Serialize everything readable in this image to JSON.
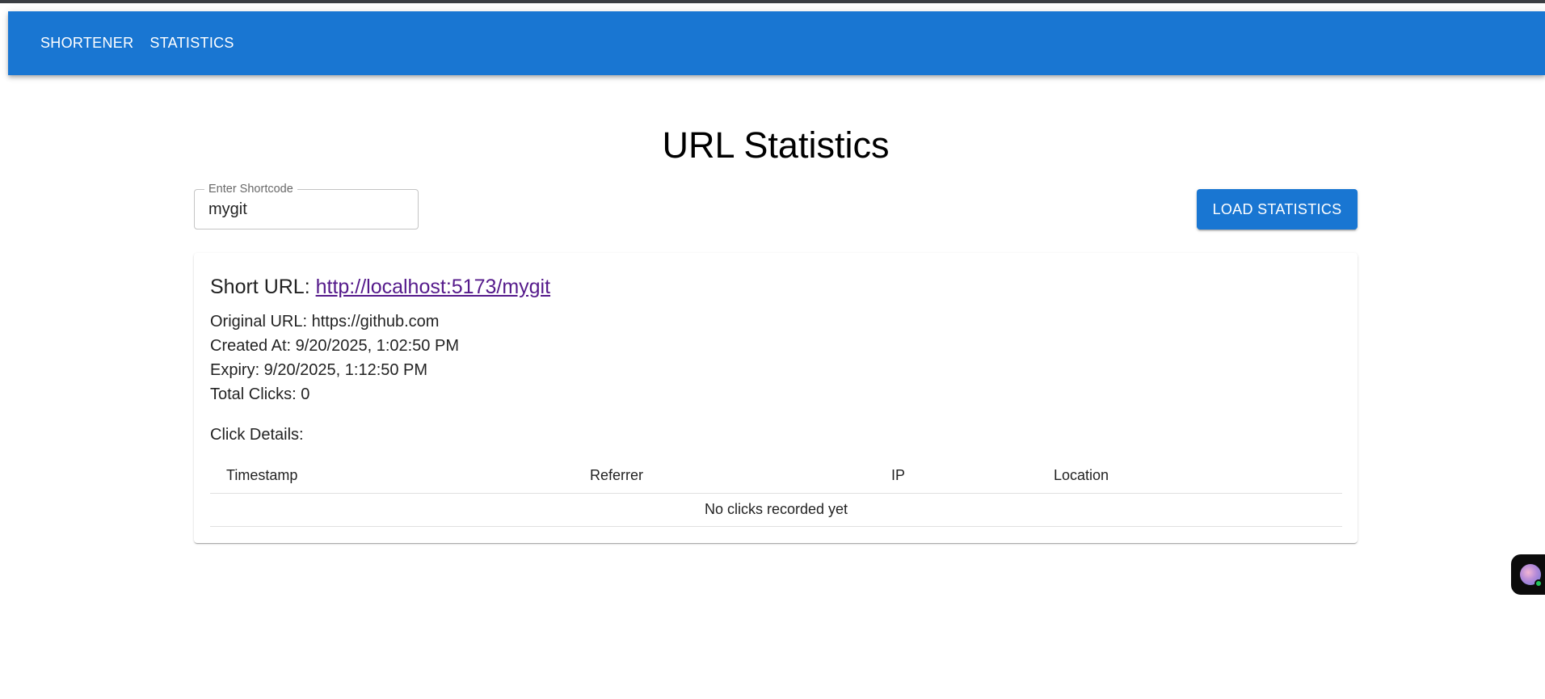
{
  "nav": {
    "items": [
      {
        "label": "SHORTENER"
      },
      {
        "label": "STATISTICS"
      }
    ]
  },
  "page": {
    "title": "URL Statistics"
  },
  "form": {
    "shortcode_label": "Enter Shortcode",
    "shortcode_value": "mygit",
    "load_button_label": "LOAD STATISTICS"
  },
  "stats": {
    "short_url_prefix": "Short URL: ",
    "short_url": "http://localhost:5173/mygit",
    "original_url": "Original URL: https://github.com",
    "created_at": "Created At: 9/20/2025, 1:02:50 PM",
    "expiry": "Expiry: 9/20/2025, 1:12:50 PM",
    "total_clicks": "Total Clicks: 0",
    "click_details_heading": "Click Details:"
  },
  "table": {
    "columns": [
      "Timestamp",
      "Referrer",
      "IP",
      "Location"
    ],
    "empty_message": "No clicks recorded yet"
  },
  "colors": {
    "primary": "#1976d2",
    "link_visited": "#551a8b"
  },
  "widget": {
    "icon": "chat-assistant-icon",
    "status": "online"
  }
}
